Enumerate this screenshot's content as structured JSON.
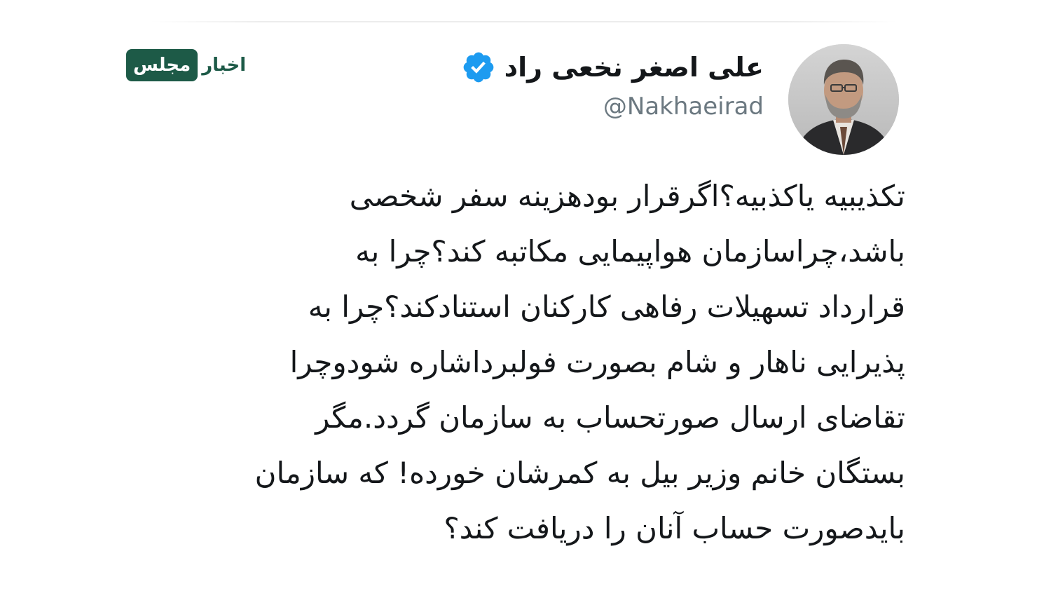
{
  "logo": {
    "box_text": "مجلس",
    "plain_text": "اخبار",
    "color": "#1d5a47"
  },
  "author": {
    "display_name": "علی اصغر نخعی راد",
    "handle": "@Nakhaeirad",
    "verified_icon": "verified-badge-icon",
    "verified_color": "#1d9bf0"
  },
  "tweet": {
    "lines": [
      "تکذیبیه یاکذبیه؟اگرقرار بودهزینه سفر شخصی",
      "باشد،چراسازمان هواپیمایی مکاتبه کند؟چرا به",
      "قرارداد تسهیلات رفاهی کارکنان استنادکند؟چرا به",
      "پذیرایی ناهار و شام بصورت فولبرداشاره شودوچرا",
      "تقاضای ارسال صورتحساب به سازمان گردد.مگر",
      "بستگان خانم وزیر بیل به کمرشان خورده! که سازمان",
      "بایدصورت حساب آنان را دریافت کند؟"
    ]
  }
}
